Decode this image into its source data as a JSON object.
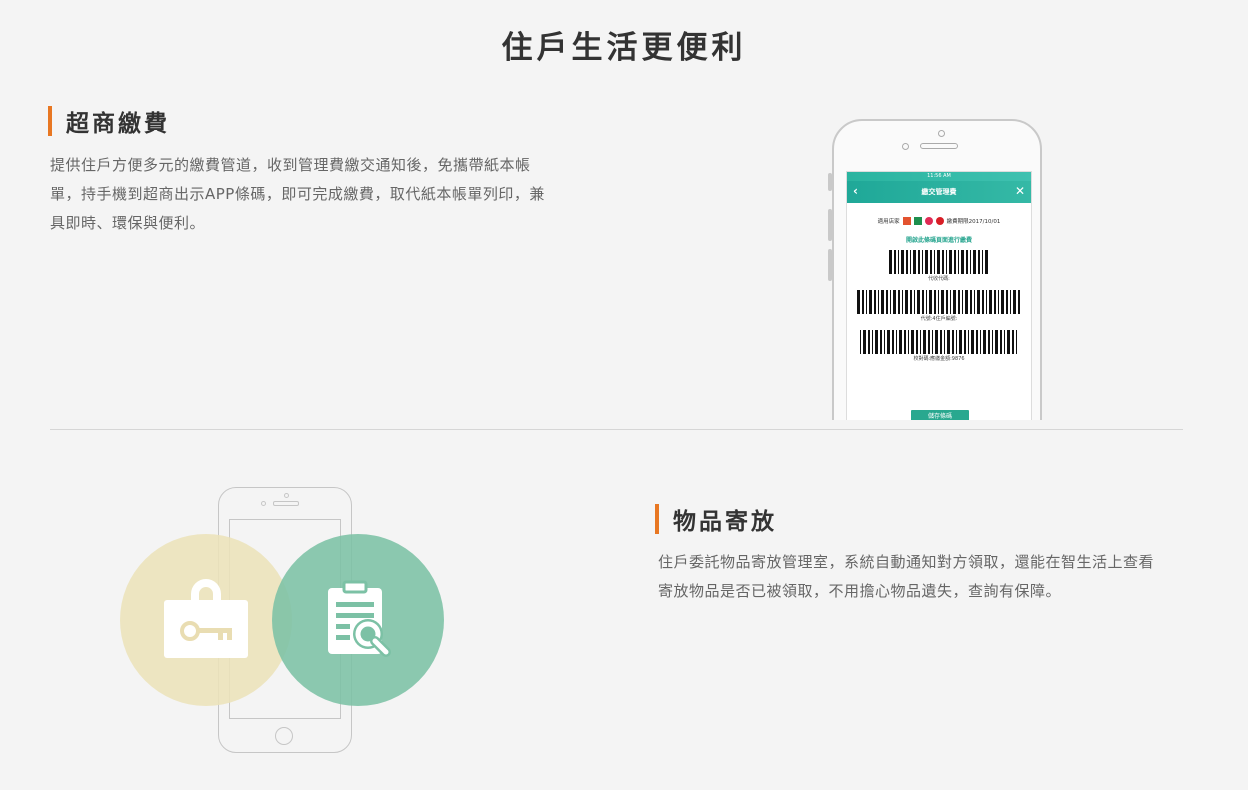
{
  "page": {
    "title": "住戶生活更便利"
  },
  "section1": {
    "title": "超商繳費",
    "lines": [
      "提供住戶方便多元的繳費管道，收到管理費繳交通知後，免攜帶紙本帳",
      "單，持手機到超商出示APP條碼，即可完成繳費，取代紙本帳單列印，兼",
      "具即時、環保與便利。"
    ]
  },
  "section2": {
    "title": "物品寄放",
    "lines": [
      "住戶委託物品寄放管理室，系統自動通知對方領取，還能在智生活上查看",
      "寄放物品是否已被領取，不用擔心物品遺失，查詢有保障。"
    ]
  },
  "phone_app": {
    "status_time": "11:56 AM",
    "header_title": "繳交管理費",
    "stores_label": "適用店家",
    "deadline": "繳費期限2017/10/01",
    "barcode_hint": "開啟此條碼頁面進行繳費",
    "barcode1_label": "代收代碼:",
    "barcode2_label": "代號:4住戶編號:",
    "barcode3_label": "校對碼:應繳金額:9876",
    "save_button": "儲存條碼"
  },
  "icons": {
    "locker": "locker-key-icon",
    "search": "clipboard-search-icon"
  },
  "colors": {
    "accent": "#e87722",
    "app_teal": "#29a88f",
    "circle_yellow": "#ece2ba",
    "circle_green": "#7cc1a5"
  }
}
